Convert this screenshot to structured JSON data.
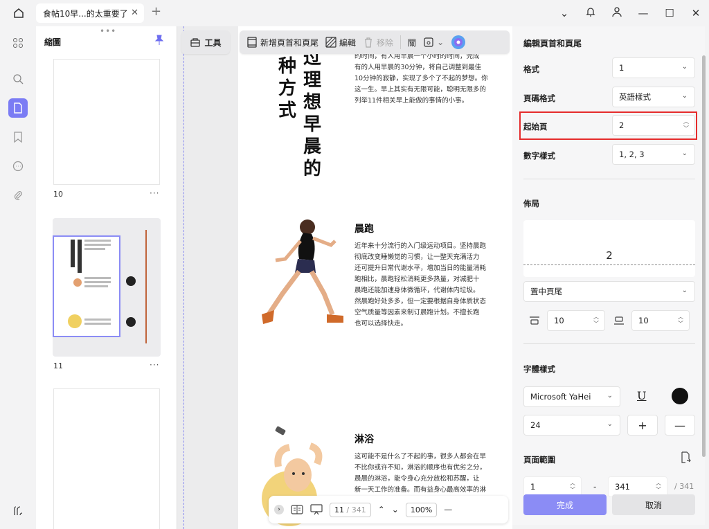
{
  "tab": {
    "title": "食帖10早...的太重要了"
  },
  "thumbs": {
    "title": "縮圖",
    "pages": [
      {
        "label": "10",
        "more": "···"
      },
      {
        "label": "11",
        "more": "···"
      },
      {
        "label": "",
        "more": ""
      }
    ]
  },
  "toolbar": {
    "tools_label": "工具",
    "add_header_footer": "新增頁首和頁尾",
    "edit": "編輯",
    "remove": "移除",
    "cut_label": "關"
  },
  "document": {
    "vertical_title_1": "种方式",
    "vertical_title_2": "过理想早晨的",
    "intro_text": [
      "的时间，有人用早晨一个小时的时间，完成",
      "有的人用早晨的30分钟，将自己调整到最佳",
      "10分钟的寂静，实现了多个了不起的梦想。你",
      "这一生。早上其实有无限可能，聪明无限多的",
      "列举11件相关早上能做的事情的小事。"
    ],
    "section1_title": "晨跑",
    "section1_text": [
      "近年来十分流行的入门级运动项目。坚持晨跑",
      "彻底改变睡懒觉的习惯，让一整天充满活力",
      "还可提升日常代谢水平，增加当日的能量消耗",
      "跑相比，晨跑轻松消耗更多热量，对减肥十",
      "晨跑还能加速身体微循环，代谢体内垃圾。",
      "然晨跑好处多多，但一定要根据自身体质状态",
      "空气质量等因素来制订晨跑计划。不擅长跑",
      "也可以选择快走。"
    ],
    "section2_title": "淋浴",
    "section2_text": [
      "这可能不是什么了不起的事，很多人都会在早",
      "不比你或许不知，淋浴的顺序也有优劣之分，",
      "晨晨的淋浴，能令身心充分放松和苏醒，让",
      "新一天工作的准备。而有益身心最高效率的淋"
    ]
  },
  "bottom_bar": {
    "page_current": "11",
    "page_total": "/ 341",
    "zoom": "100%"
  },
  "panel": {
    "title": "編輯頁首和頁尾",
    "format_label": "格式",
    "format_value": "1",
    "page_format_label": "頁碼格式",
    "page_format_value": "英語樣式",
    "start_page_label": "起始頁",
    "start_page_value": "2",
    "number_style_label": "數字樣式",
    "number_style_value": "1, 2, 3",
    "layout_label": "佈局",
    "preview_number": "2",
    "position_value": "置中頁尾",
    "margin_top_value": "10",
    "margin_bottom_value": "10",
    "font_style_label": "字體樣式",
    "font_family_value": "Microsoft YaHei",
    "font_size_value": "24",
    "underline_glyph": "U",
    "page_range_label": "頁面範圍",
    "range_from": "1",
    "range_sep": "-",
    "range_to": "341",
    "range_total": "/ 341",
    "done_label": "完成",
    "cancel_label": "取消"
  },
  "colors": {
    "accent": "#7b7cf4",
    "highlight": "#e52b2b"
  }
}
